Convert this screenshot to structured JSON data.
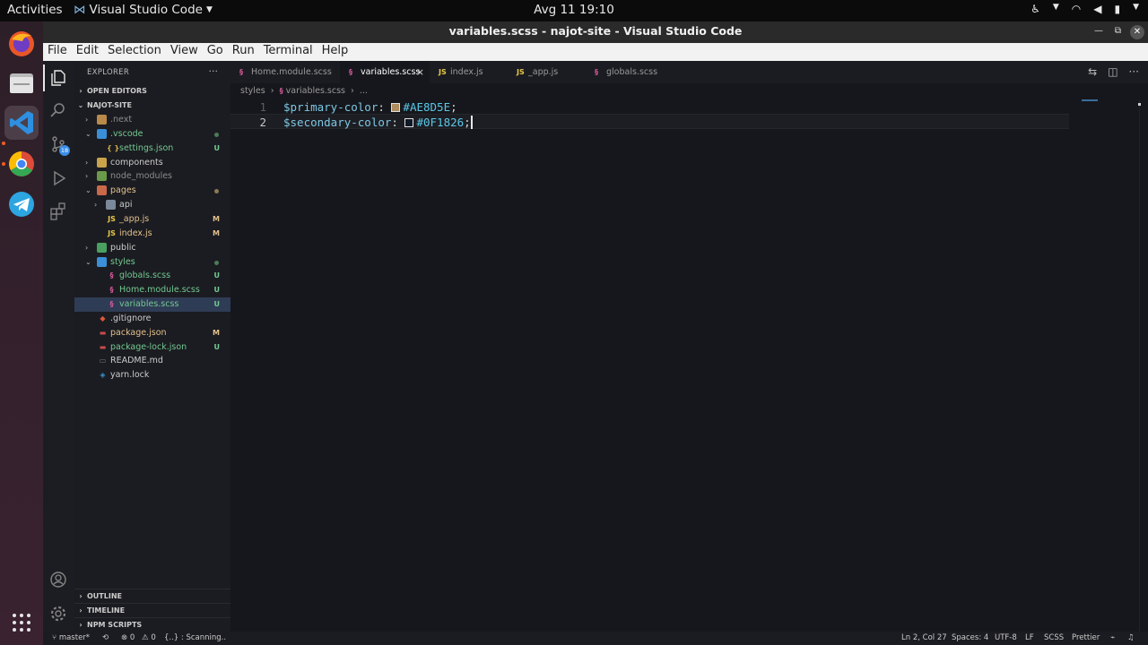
{
  "system": {
    "activities": "Activities",
    "app_menu": "Visual Studio Code",
    "clock": "Avg 11  19:10"
  },
  "window": {
    "title": "variables.scss - najot-site - Visual Studio Code"
  },
  "menubar": [
    "File",
    "Edit",
    "Selection",
    "View",
    "Go",
    "Run",
    "Terminal",
    "Help"
  ],
  "activitybar": {
    "source_control_badge": "18"
  },
  "explorer": {
    "title": "EXPLORER",
    "more": "···",
    "open_editors": "OPEN EDITORS",
    "project": "NAJOT-SITE",
    "tree": [
      {
        "label": ".next",
        "kind": "folder",
        "chevron": "›",
        "status": ""
      },
      {
        "label": ".vscode",
        "kind": "folder",
        "chevron": "⌄",
        "status": "dot"
      },
      {
        "label": "settings.json",
        "kind": "json",
        "icon_text": "{ }",
        "status": "U"
      },
      {
        "label": "components",
        "kind": "folder",
        "chevron": "›",
        "status": ""
      },
      {
        "label": "node_modules",
        "kind": "folder",
        "chevron": "›",
        "status": ""
      },
      {
        "label": "pages",
        "kind": "folder",
        "chevron": "⌄",
        "status": "dot"
      },
      {
        "label": "api",
        "kind": "folder",
        "chevron": "›",
        "status": ""
      },
      {
        "label": "_app.js",
        "kind": "js",
        "icon_text": "JS",
        "status": "M"
      },
      {
        "label": "index.js",
        "kind": "js",
        "icon_text": "JS",
        "status": "M"
      },
      {
        "label": "public",
        "kind": "folder",
        "chevron": "›",
        "status": ""
      },
      {
        "label": "styles",
        "kind": "folder",
        "chevron": "⌄",
        "status": "dot"
      },
      {
        "label": "globals.scss",
        "kind": "scss",
        "icon_text": "§",
        "status": "U"
      },
      {
        "label": "Home.module.scss",
        "kind": "scss",
        "icon_text": "§",
        "status": "U"
      },
      {
        "label": "variables.scss",
        "kind": "scss",
        "icon_text": "§",
        "status": "U"
      },
      {
        "label": ".gitignore",
        "kind": "git",
        "icon_text": "◆",
        "status": ""
      },
      {
        "label": "package.json",
        "kind": "npm",
        "icon_text": "▬",
        "status": "M"
      },
      {
        "label": "package-lock.json",
        "kind": "npm",
        "icon_text": "▬",
        "status": "U"
      },
      {
        "label": "README.md",
        "kind": "md",
        "icon_text": "▭",
        "status": ""
      },
      {
        "label": "yarn.lock",
        "kind": "yarn",
        "icon_text": "◈",
        "status": ""
      }
    ],
    "outline": "OUTLINE",
    "timeline": "TIMELINE",
    "npm_scripts": "NPM SCRIPTS"
  },
  "tabs": [
    {
      "label": "Home.module.scss",
      "icon_text": "§"
    },
    {
      "label": "variables.scss",
      "icon_text": "§",
      "close": "×"
    },
    {
      "label": "index.js",
      "icon_text": "JS"
    },
    {
      "label": "_app.js",
      "icon_text": "JS"
    },
    {
      "label": "globals.scss",
      "icon_text": "§"
    }
  ],
  "breadcrumb": {
    "folder": "styles",
    "sep": "›",
    "file": "variables.scss",
    "tail": "..."
  },
  "editor": {
    "lines": [
      {
        "num": "1",
        "var": "$primary-color",
        "colon": ": ",
        "value": "#AE8D5E",
        "end": ";"
      },
      {
        "num": "2",
        "var": "$secondary-color",
        "colon": ": ",
        "value": "#0F1826",
        "end": ";"
      }
    ]
  },
  "statusbar": {
    "branch": "master*",
    "errors": "⊗ 0",
    "warnings": "⚠ 0",
    "scanning": "{..} : Scanning..",
    "position": "Ln 2, Col 27",
    "spaces": "Spaces: 4",
    "encoding": "UTF-8",
    "eol": "LF",
    "language": "SCSS",
    "formatter": "Prettier"
  },
  "colors": {
    "swatch_primary": "#AE8D5E",
    "swatch_secondary": "#0F1826",
    "accent": "#3b8eea"
  }
}
